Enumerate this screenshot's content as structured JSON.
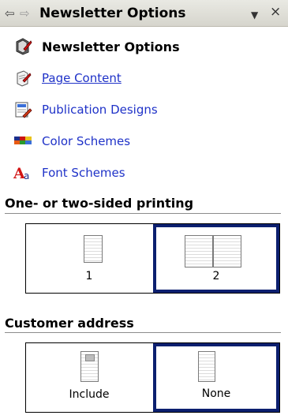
{
  "titlebar": {
    "back": "⇦",
    "forward": "⇨",
    "title": "Newsletter Options",
    "dropdown": "▼",
    "close": "×"
  },
  "nav": [
    {
      "label": "Newsletter Options",
      "icon": "newsletter-options-icon"
    },
    {
      "label": "Page Content",
      "icon": "page-content-icon"
    },
    {
      "label": "Publication Designs",
      "icon": "publication-designs-icon"
    },
    {
      "label": "Color Schemes",
      "icon": "color-schemes-icon"
    },
    {
      "label": "Font Schemes",
      "icon": "font-schemes-icon"
    }
  ],
  "printing": {
    "title": "One- or two-sided printing",
    "options": [
      {
        "label": "1",
        "selected": false
      },
      {
        "label": "2",
        "selected": true
      }
    ]
  },
  "address": {
    "title": "Customer address",
    "options": [
      {
        "label": "Include",
        "selected": false
      },
      {
        "label": "None",
        "selected": true
      }
    ]
  },
  "colors": {
    "link": "#1f32c8",
    "selection_border": "#0c1f6f"
  }
}
